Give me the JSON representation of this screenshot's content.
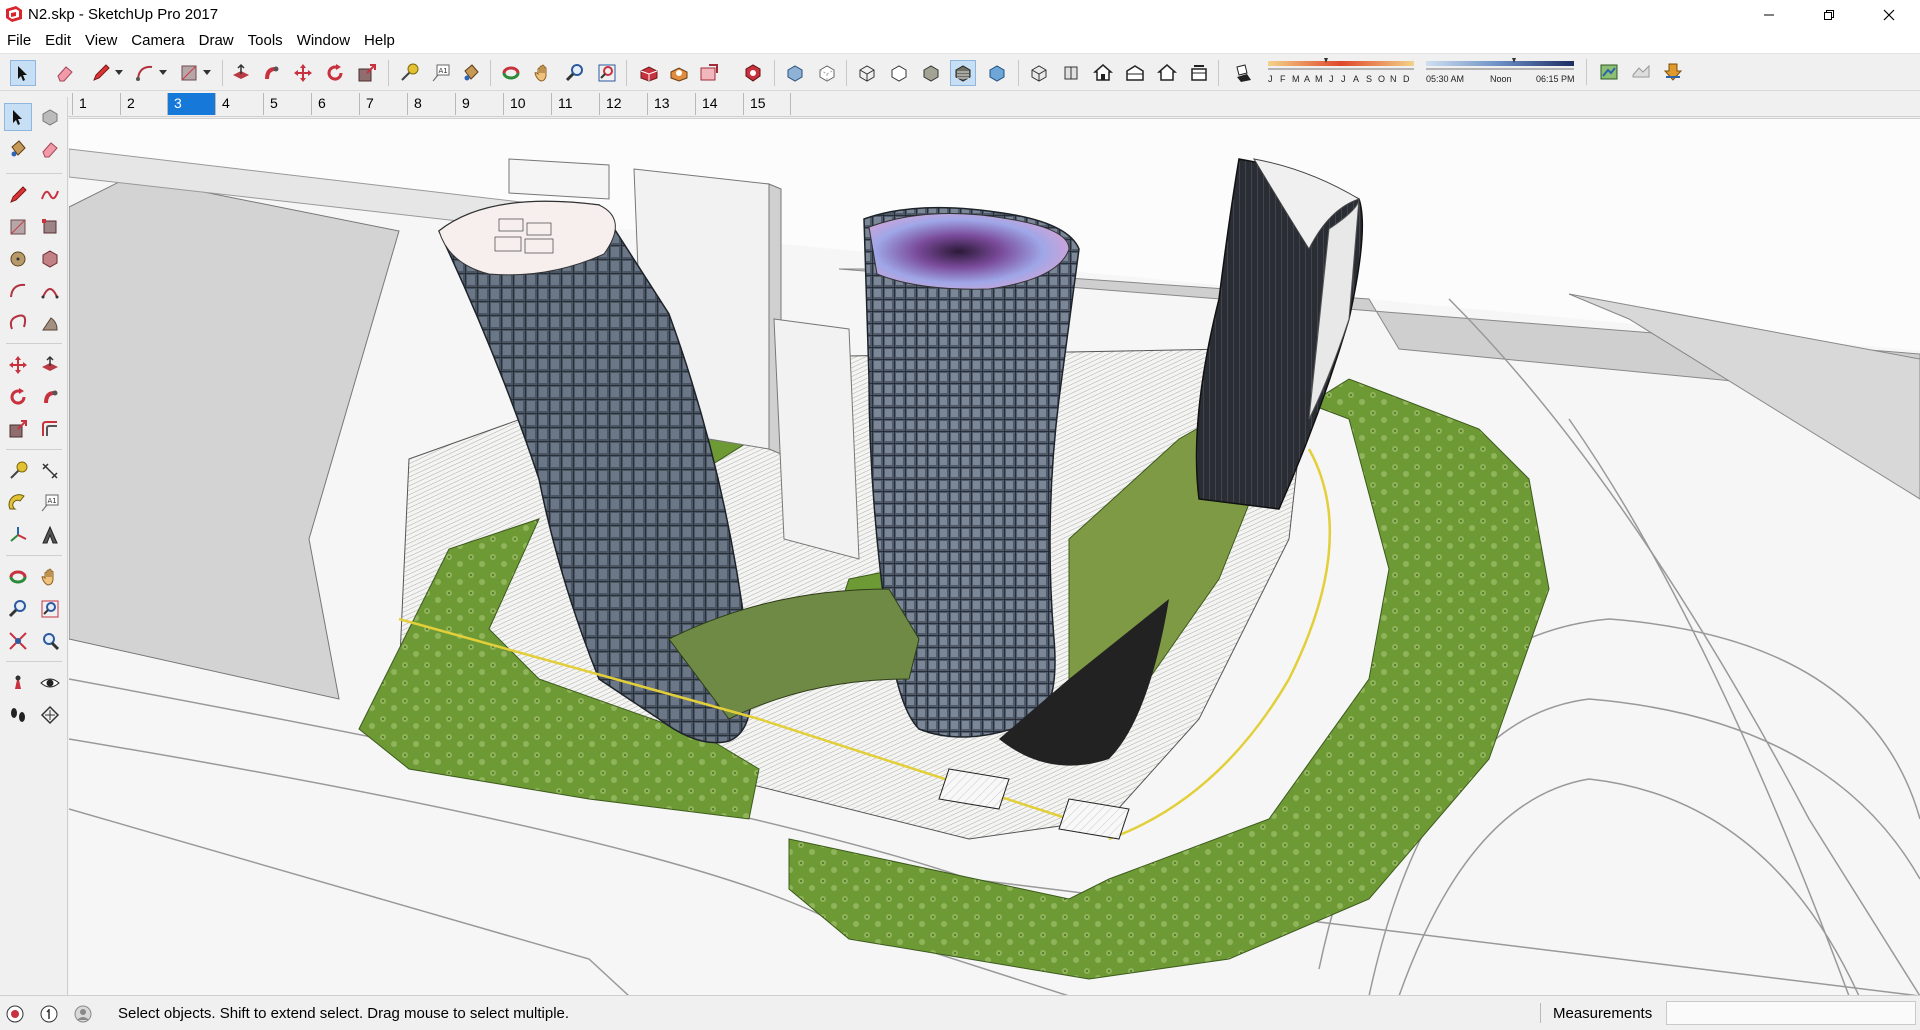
{
  "window": {
    "title": "N2.skp - SketchUp Pro 2017"
  },
  "menu": {
    "items": [
      "File",
      "Edit",
      "View",
      "Camera",
      "Draw",
      "Tools",
      "Window",
      "Help"
    ]
  },
  "toolbar": {
    "shadow_months": [
      "J",
      "F",
      "M",
      "A",
      "M",
      "J",
      "J",
      "A",
      "S",
      "O",
      "N",
      "D"
    ],
    "shadow_time_start": "05:30 AM",
    "shadow_time_mid": "Noon",
    "shadow_time_end": "06:15 PM"
  },
  "scenes": {
    "tabs": [
      "1",
      "2",
      "3",
      "4",
      "5",
      "6",
      "7",
      "8",
      "9",
      "10",
      "11",
      "12",
      "13",
      "14",
      "15"
    ],
    "active": "3"
  },
  "status": {
    "hint": "Select objects. Shift to extend select. Drag mouse to select multiple.",
    "measurements_label": "Measurements",
    "measurements_value": ""
  },
  "colors": {
    "accent": "#1679d9",
    "active_tool_bg": "#c7dff5",
    "grass": "#6e9a35",
    "tower_glass": "#3f4a57"
  }
}
